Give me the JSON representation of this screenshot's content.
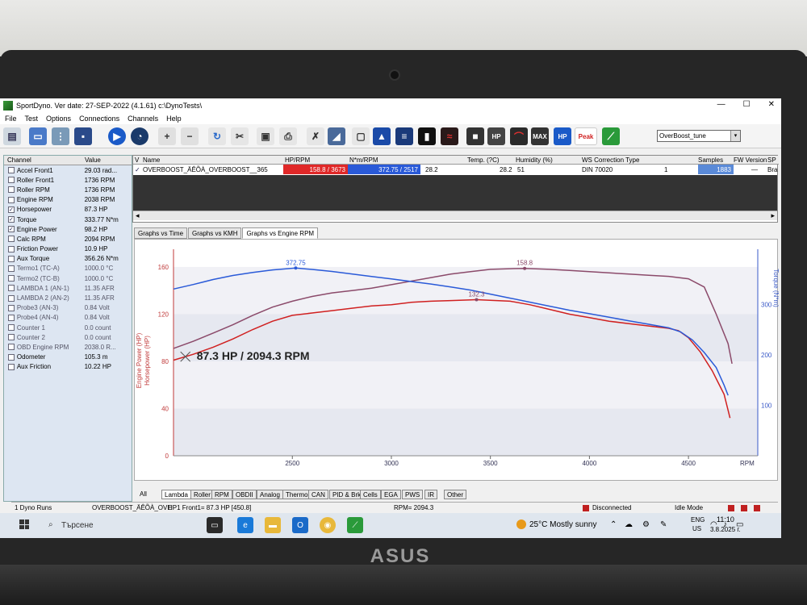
{
  "window": {
    "title": "SportDyno. Ver date: 27-SEP-2022 (4.1.61)  c:\\DynoTests\\",
    "min": "—",
    "max": "☐",
    "close": "✕"
  },
  "menu": [
    "File",
    "Test",
    "Options",
    "Connections",
    "Channels",
    "Help"
  ],
  "toolbar": {
    "hp_label": "HP",
    "max_label": "MAX",
    "hp2_label": "HP",
    "peak_label": "Peak",
    "profile_value": "OverBoost_tune",
    "profile_arrow": "▾"
  },
  "channels": {
    "header_name": "Channel",
    "header_value": "Value",
    "check_mark": "✓",
    "rows": [
      {
        "name": "Accel Front1",
        "value": "29.03 rad...",
        "checked": false,
        "dim": false
      },
      {
        "name": "Roller Front1",
        "value": "1736 RPM",
        "checked": false,
        "dim": false
      },
      {
        "name": "Roller RPM",
        "value": "1736 RPM",
        "checked": false,
        "dim": false
      },
      {
        "name": "Engine RPM",
        "value": "2038 RPM",
        "checked": false,
        "dim": false
      },
      {
        "name": "Horsepower",
        "value": "87.3 HP",
        "checked": true,
        "dim": false
      },
      {
        "name": "Torque",
        "value": "333.77 N*m",
        "checked": true,
        "dim": false
      },
      {
        "name": "Engine Power",
        "value": "98.2 HP",
        "checked": true,
        "dim": false
      },
      {
        "name": "Calc RPM",
        "value": "2094 RPM",
        "checked": false,
        "dim": false
      },
      {
        "name": "Friction Power",
        "value": "10.9 HP",
        "checked": false,
        "dim": false
      },
      {
        "name": "Aux Torque",
        "value": "356.26 N*m",
        "checked": false,
        "dim": false
      },
      {
        "name": "Termo1 (TC-A)",
        "value": "1000.0 °C",
        "checked": false,
        "dim": true
      },
      {
        "name": "Termo2 (TC-B)",
        "value": "1000.0 °C",
        "checked": false,
        "dim": true
      },
      {
        "name": "LAMBDA 1 (AN-1)",
        "value": "11.35 AFR",
        "checked": false,
        "dim": true
      },
      {
        "name": "LAMBDA 2 (AN-2)",
        "value": "11.35 AFR",
        "checked": false,
        "dim": true
      },
      {
        "name": "Probe3 (AN-3)",
        "value": "0.84 Volt",
        "checked": false,
        "dim": true
      },
      {
        "name": "Probe4 (AN-4)",
        "value": "0.84 Volt",
        "checked": false,
        "dim": true
      },
      {
        "name": "Counter 1",
        "value": "0.0 count",
        "checked": false,
        "dim": true
      },
      {
        "name": "Counter 2",
        "value": "0.0 count",
        "checked": false,
        "dim": true
      },
      {
        "name": "OBD Engine RPM",
        "value": "2038.0 R...",
        "checked": false,
        "dim": true
      },
      {
        "name": "Odometer",
        "value": "105.3 m",
        "checked": false,
        "dim": false
      },
      {
        "name": "Aux Friction",
        "value": "10.22 HP",
        "checked": false,
        "dim": false
      }
    ]
  },
  "runs": {
    "headers": {
      "v": "V",
      "name": "Name",
      "hp": "HP/RPM",
      "nm": "N*m/RPM",
      "temp": "Temp. (?C)",
      "humidity": "Humidity (%)",
      "ws": "WS Correction Type",
      "samples": "Samples",
      "fw": "FW Version",
      "sp": "SP"
    },
    "row": {
      "check": "✓",
      "name": "OVERBOOST_ÄÊÕÀ_OVERBOOST__365",
      "hp": "158.8 / 3673",
      "nm": "372.75 / 2517",
      "val1": "28.2",
      "temp": "28.2",
      "humidity": "51",
      "ws": "DIN 70020",
      "idx": "1",
      "samples": "1883",
      "fw": "—",
      "sp": "Bra"
    },
    "scroll_left": "◂",
    "scroll_right": "▸"
  },
  "graph_tabs": [
    "Graphs vs Time",
    "Graphs vs KMH",
    "Graphs vs Engine RPM"
  ],
  "bottom_tabs": [
    "All",
    "Lambda",
    "Roller",
    "RPM",
    "OBDII",
    "Analog",
    "Thermo",
    "CAN",
    "PID & Brk",
    "Cells",
    "EGA",
    "PWS",
    "IR",
    "Other"
  ],
  "status": {
    "runs": "1 Dyno Runs",
    "name": "OVERBOOST_ÄÊÕÀ_OVE",
    "hp1": "HP1 Front1= 87.3 HP  [450.8]",
    "rpm": "RPM= 2094.3",
    "disconnected": "Disconnected",
    "mode": "Idle Mode"
  },
  "chart_data": {
    "type": "line",
    "cursor_label": "87.3 HP / 2094.3 RPM",
    "ylabel_left_1": "Engine Power (HP)",
    "ylabel_left_2": "Horsepower (HP)",
    "ylabel_right": "Torque (N*m)",
    "xlabel": "RPM",
    "xlim": [
      1900,
      4850
    ],
    "ylim_left": [
      0,
      175
    ],
    "ylim_right": [
      0,
      410
    ],
    "x_ticks": [
      2500,
      3000,
      3500,
      4000,
      4500
    ],
    "y_ticks_left": [
      0,
      40,
      80,
      120,
      160
    ],
    "y_ticks_right": [
      100,
      200,
      300
    ],
    "peak_labels": [
      {
        "text": "372.75",
        "x": 2517,
        "y": 372.75,
        "axis": "right"
      },
      {
        "text": "158.8",
        "x": 3673,
        "y": 158.8,
        "axis": "left"
      },
      {
        "text": "132.3",
        "x": 3430,
        "y": 132.3,
        "axis": "left"
      }
    ],
    "series": [
      {
        "color": "#8b4a6a",
        "axis": "left",
        "points": [
          [
            1900,
            91
          ],
          [
            2000,
            97
          ],
          [
            2100,
            104
          ],
          [
            2200,
            111
          ],
          [
            2300,
            119
          ],
          [
            2400,
            126
          ],
          [
            2500,
            131
          ],
          [
            2600,
            135
          ],
          [
            2700,
            138
          ],
          [
            2800,
            140
          ],
          [
            2900,
            142
          ],
          [
            3000,
            145
          ],
          [
            3100,
            148
          ],
          [
            3200,
            151
          ],
          [
            3300,
            154
          ],
          [
            3400,
            156
          ],
          [
            3500,
            158
          ],
          [
            3600,
            158.5
          ],
          [
            3673,
            158.8
          ],
          [
            3800,
            158
          ],
          [
            3900,
            157
          ],
          [
            4000,
            156
          ],
          [
            4100,
            155
          ],
          [
            4200,
            154
          ],
          [
            4300,
            153
          ],
          [
            4400,
            152
          ],
          [
            4500,
            150
          ],
          [
            4580,
            143
          ],
          [
            4640,
            120
          ],
          [
            4700,
            95
          ],
          [
            4720,
            78
          ]
        ]
      },
      {
        "color": "#d02020",
        "axis": "left",
        "points": [
          [
            1900,
            81
          ],
          [
            2000,
            86
          ],
          [
            2100,
            92
          ],
          [
            2200,
            99
          ],
          [
            2300,
            107
          ],
          [
            2400,
            114
          ],
          [
            2500,
            119
          ],
          [
            2600,
            121
          ],
          [
            2700,
            123
          ],
          [
            2800,
            125
          ],
          [
            2900,
            127
          ],
          [
            3000,
            128
          ],
          [
            3100,
            130
          ],
          [
            3200,
            131
          ],
          [
            3300,
            131.5
          ],
          [
            3430,
            132.3
          ],
          [
            3600,
            131
          ],
          [
            3700,
            128
          ],
          [
            3800,
            124
          ],
          [
            3900,
            120
          ],
          [
            4000,
            117
          ],
          [
            4100,
            114
          ],
          [
            4200,
            112
          ],
          [
            4300,
            110
          ],
          [
            4400,
            108
          ],
          [
            4450,
            106
          ],
          [
            4500,
            100
          ],
          [
            4560,
            88
          ],
          [
            4620,
            72
          ],
          [
            4680,
            52
          ],
          [
            4710,
            32
          ]
        ]
      },
      {
        "color": "#2a5ad8",
        "axis": "right",
        "points": [
          [
            1900,
            331
          ],
          [
            2000,
            340
          ],
          [
            2100,
            350
          ],
          [
            2200,
            358
          ],
          [
            2300,
            364
          ],
          [
            2400,
            369
          ],
          [
            2517,
            372.75
          ],
          [
            2600,
            370
          ],
          [
            2700,
            366
          ],
          [
            2800,
            361
          ],
          [
            2900,
            356
          ],
          [
            3000,
            351
          ],
          [
            3100,
            346
          ],
          [
            3200,
            341
          ],
          [
            3300,
            335
          ],
          [
            3400,
            329
          ],
          [
            3500,
            321
          ],
          [
            3600,
            313
          ],
          [
            3700,
            305
          ],
          [
            3800,
            297
          ],
          [
            3900,
            289
          ],
          [
            4000,
            282
          ],
          [
            4100,
            275
          ],
          [
            4200,
            268
          ],
          [
            4300,
            261
          ],
          [
            4400,
            254
          ],
          [
            4460,
            246
          ],
          [
            4520,
            230
          ],
          [
            4580,
            205
          ],
          [
            4640,
            175
          ],
          [
            4680,
            140
          ],
          [
            4700,
            120
          ]
        ]
      }
    ]
  },
  "taskbar": {
    "search_label": "Търсене",
    "weather": "25°C  Mostly sunny",
    "lang_1": "ENG",
    "lang_2": "US",
    "time": "11:10",
    "date": "3.8.2025 г."
  }
}
